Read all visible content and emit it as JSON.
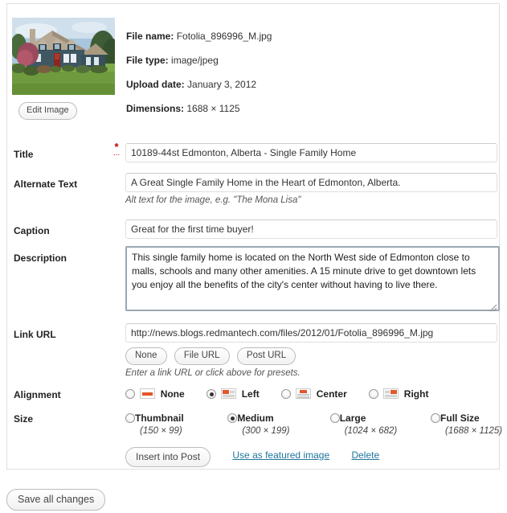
{
  "media": {
    "thumbnail_alt": "house-photo-thumbnail",
    "edit_image_label": "Edit Image",
    "meta": [
      {
        "label": "File name:",
        "value": "Fotolia_896996_M.jpg"
      },
      {
        "label": "File type:",
        "value": "image/jpeg"
      },
      {
        "label": "Upload date:",
        "value": "January 3, 2012"
      },
      {
        "label": "Dimensions:",
        "value": "1688 × 1125"
      }
    ]
  },
  "fields": {
    "title": {
      "label": "Title",
      "required_mark": "*",
      "required_dots": "...",
      "value": "10189-44st Edmonton, Alberta - Single Family Home",
      "placeholder": ""
    },
    "alt_text": {
      "label": "Alternate Text",
      "value": "A Great Single Family Home in the Heart of Edmonton, Alberta.",
      "placeholder": "",
      "help": "Alt text for the image, e.g. \"The Mona Lisa\""
    },
    "caption": {
      "label": "Caption",
      "value": "Great for the first time buyer!",
      "placeholder": ""
    },
    "description": {
      "label": "Description",
      "value": "This single family home is located on the North West side of Edmonton close to malls, schools and many other amenities. A 15 minute drive to get downtown lets you enjoy all the benefits of the city's center without having to live there.",
      "placeholder": ""
    },
    "link_url": {
      "label": "Link URL",
      "value": "http://news.blogs.redmantech.com/files/2012/01/Fotolia_896996_M.jpg",
      "placeholder": "",
      "help": "Enter a link URL or click above for presets.",
      "presets": [
        "None",
        "File URL",
        "Post URL"
      ]
    },
    "alignment": {
      "label": "Alignment",
      "selected": "Left",
      "options": [
        {
          "label": "None",
          "icon": "align-none-icon"
        },
        {
          "label": "Left",
          "icon": "align-left-icon"
        },
        {
          "label": "Center",
          "icon": "align-center-icon"
        },
        {
          "label": "Right",
          "icon": "align-right-icon"
        }
      ]
    },
    "size": {
      "label": "Size",
      "selected": "Medium",
      "options": [
        {
          "label": "Thumbnail",
          "dims": "(150 × 99)"
        },
        {
          "label": "Medium",
          "dims": "(300 × 199)"
        },
        {
          "label": "Large",
          "dims": "(1024 × 682)"
        },
        {
          "label": "Full Size",
          "dims": "(1688 × 1125)"
        }
      ]
    }
  },
  "actions": {
    "insert_label": "Insert into Post",
    "featured_label": "Use as featured image",
    "delete_label": "Delete",
    "save_all_label": "Save all changes"
  },
  "colors": {
    "link": "#21759b",
    "required": "#c00000",
    "accent_orange": "#e2572b",
    "panel_border": "#dfdfdf",
    "focus_border": "#9aa8b2"
  }
}
